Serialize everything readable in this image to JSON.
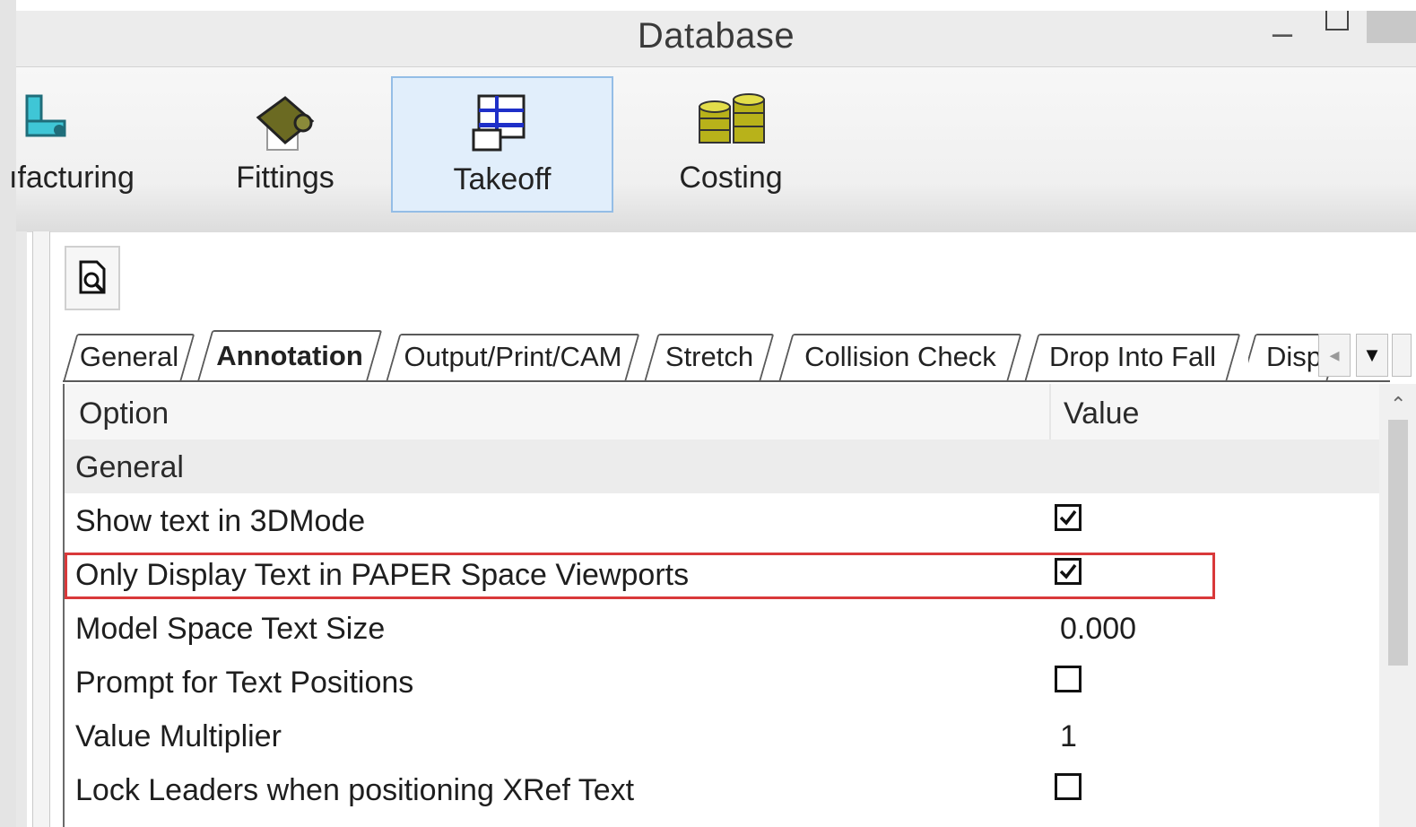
{
  "window": {
    "title": "Database"
  },
  "ribbon": {
    "buttons": [
      {
        "label": "ıfacturing",
        "icon": "manufacturing-icon"
      },
      {
        "label": "Fittings",
        "icon": "fittings-icon"
      },
      {
        "label": "Takeoff",
        "icon": "takeoff-icon",
        "selected": true
      },
      {
        "label": "Costing",
        "icon": "costing-icon"
      }
    ]
  },
  "toolbar": {
    "preview_icon": "document-search-icon"
  },
  "tabs": [
    {
      "label": "General"
    },
    {
      "label": "Annotation",
      "active": true
    },
    {
      "label": "Output/Print/CAM"
    },
    {
      "label": "Stretch"
    },
    {
      "label": "Collision Check"
    },
    {
      "label": "Drop Into Fall"
    },
    {
      "label": "Disp"
    }
  ],
  "grid": {
    "header_option": "Option",
    "header_value": "Value",
    "category": "General",
    "rows": [
      {
        "option": "Show text in 3DMode",
        "type": "checkbox",
        "checked": true
      },
      {
        "option": "Only Display Text in PAPER Space Viewports",
        "type": "checkbox",
        "checked": true,
        "highlighted": true
      },
      {
        "option": "Model Space Text Size",
        "type": "text",
        "value": "0.000"
      },
      {
        "option": "Prompt for Text Positions",
        "type": "checkbox",
        "checked": false
      },
      {
        "option": "Value Multiplier",
        "type": "text",
        "value": "1"
      },
      {
        "option": "Lock Leaders when positioning XRef Text",
        "type": "checkbox",
        "checked": false
      }
    ]
  },
  "colors": {
    "highlight_border": "#d9393a",
    "selected_ribbon_bg": "#e1eefb",
    "selected_ribbon_border": "#94bde6"
  }
}
